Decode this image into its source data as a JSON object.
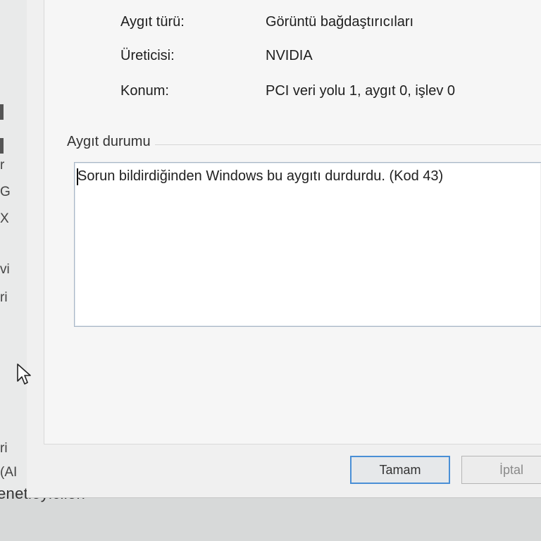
{
  "background": {
    "left_fragments": [
      "r",
      "G",
      "X",
      "vi",
      "ri",
      "ri",
      "(AI"
    ],
    "bottom_text": "enetleyicilen"
  },
  "properties": [
    {
      "label": "Aygıt türü:",
      "value": "Görüntü bağdaştırıcıları"
    },
    {
      "label": "Üreticisi:",
      "value": "NVIDIA"
    },
    {
      "label": "Konum:",
      "value": "PCI veri yolu 1, aygıt 0, işlev 0"
    }
  ],
  "status_group": {
    "title": "Aygıt durumu",
    "text": "Sorun bildirdiğinden Windows bu aygıtı durdurdu. (Kod 43)"
  },
  "buttons": {
    "ok_label": "Tamam",
    "cancel_label": "İptal"
  },
  "colors": {
    "accent": "#4a8fd6"
  }
}
